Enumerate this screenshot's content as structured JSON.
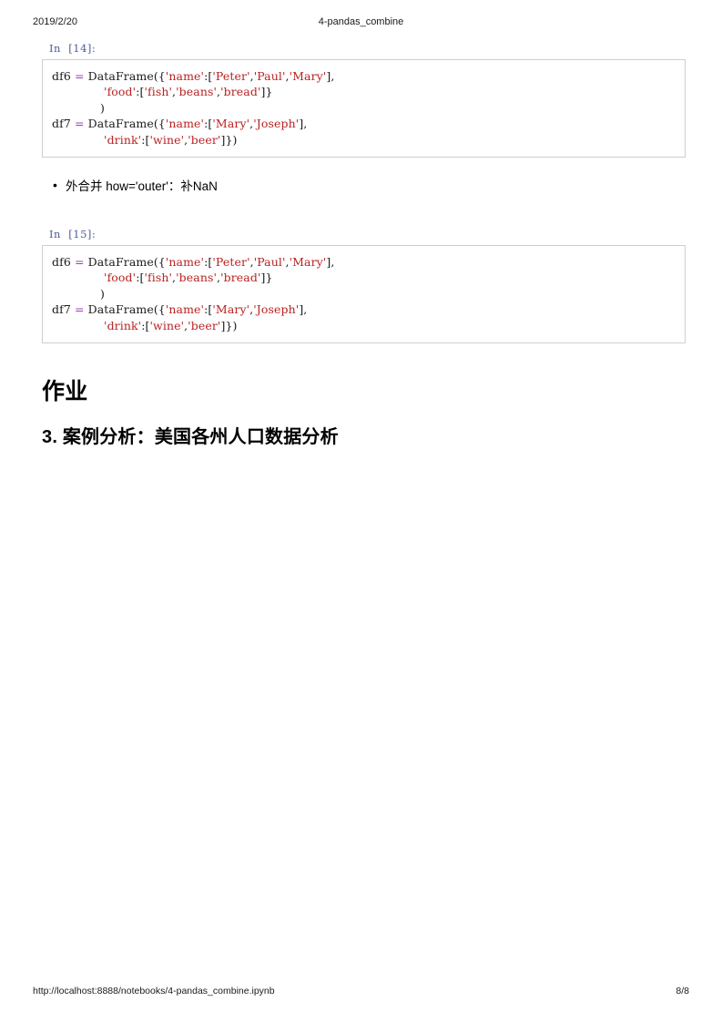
{
  "header": {
    "date": "2019/2/20",
    "title": "4-pandas_combine"
  },
  "footer": {
    "url": "http://localhost:8888/notebooks/4-pandas_combine.ipynb",
    "page": "8/8"
  },
  "cells": [
    {
      "prompt": "In  [14]:",
      "lines": [
        [
          {
            "t": "df6 ",
            "c": "name"
          },
          {
            "t": "=",
            "c": "op"
          },
          {
            "t": " DataFrame({",
            "c": "name"
          },
          {
            "t": "'name'",
            "c": "str"
          },
          {
            "t": ":[",
            "c": "name"
          },
          {
            "t": "'Peter'",
            "c": "str"
          },
          {
            "t": ",",
            "c": "name"
          },
          {
            "t": "'Paul'",
            "c": "str"
          },
          {
            "t": ",",
            "c": "name"
          },
          {
            "t": "'Mary'",
            "c": "str"
          },
          {
            "t": "],",
            "c": "name"
          }
        ],
        [
          {
            "t": "              ",
            "c": "name"
          },
          {
            "t": "'food'",
            "c": "str"
          },
          {
            "t": ":[",
            "c": "name"
          },
          {
            "t": "'fish'",
            "c": "str"
          },
          {
            "t": ",",
            "c": "name"
          },
          {
            "t": "'beans'",
            "c": "str"
          },
          {
            "t": ",",
            "c": "name"
          },
          {
            "t": "'bread'",
            "c": "str"
          },
          {
            "t": "]}",
            "c": "name"
          }
        ],
        [
          {
            "t": "             )",
            "c": "name"
          }
        ],
        [
          {
            "t": "df7 ",
            "c": "name"
          },
          {
            "t": "=",
            "c": "op"
          },
          {
            "t": " DataFrame({",
            "c": "name"
          },
          {
            "t": "'name'",
            "c": "str"
          },
          {
            "t": ":[",
            "c": "name"
          },
          {
            "t": "'Mary'",
            "c": "str"
          },
          {
            "t": ",",
            "c": "name"
          },
          {
            "t": "'Joseph'",
            "c": "str"
          },
          {
            "t": "],",
            "c": "name"
          }
        ],
        [
          {
            "t": "              ",
            "c": "name"
          },
          {
            "t": "'drink'",
            "c": "str"
          },
          {
            "t": ":[",
            "c": "name"
          },
          {
            "t": "'wine'",
            "c": "str"
          },
          {
            "t": ",",
            "c": "name"
          },
          {
            "t": "'beer'",
            "c": "str"
          },
          {
            "t": "]})",
            "c": "name"
          }
        ]
      ]
    },
    {
      "prompt": "In  [15]:",
      "lines": [
        [
          {
            "t": "df6 ",
            "c": "name"
          },
          {
            "t": "=",
            "c": "op"
          },
          {
            "t": " DataFrame({",
            "c": "name"
          },
          {
            "t": "'name'",
            "c": "str"
          },
          {
            "t": ":[",
            "c": "name"
          },
          {
            "t": "'Peter'",
            "c": "str"
          },
          {
            "t": ",",
            "c": "name"
          },
          {
            "t": "'Paul'",
            "c": "str"
          },
          {
            "t": ",",
            "c": "name"
          },
          {
            "t": "'Mary'",
            "c": "str"
          },
          {
            "t": "],",
            "c": "name"
          }
        ],
        [
          {
            "t": "              ",
            "c": "name"
          },
          {
            "t": "'food'",
            "c": "str"
          },
          {
            "t": ":[",
            "c": "name"
          },
          {
            "t": "'fish'",
            "c": "str"
          },
          {
            "t": ",",
            "c": "name"
          },
          {
            "t": "'beans'",
            "c": "str"
          },
          {
            "t": ",",
            "c": "name"
          },
          {
            "t": "'bread'",
            "c": "str"
          },
          {
            "t": "]}",
            "c": "name"
          }
        ],
        [
          {
            "t": "             )",
            "c": "name"
          }
        ],
        [
          {
            "t": "df7 ",
            "c": "name"
          },
          {
            "t": "=",
            "c": "op"
          },
          {
            "t": " DataFrame({",
            "c": "name"
          },
          {
            "t": "'name'",
            "c": "str"
          },
          {
            "t": ":[",
            "c": "name"
          },
          {
            "t": "'Mary'",
            "c": "str"
          },
          {
            "t": ",",
            "c": "name"
          },
          {
            "t": "'Joseph'",
            "c": "str"
          },
          {
            "t": "],",
            "c": "name"
          }
        ],
        [
          {
            "t": "              ",
            "c": "name"
          },
          {
            "t": "'drink'",
            "c": "str"
          },
          {
            "t": ":[",
            "c": "name"
          },
          {
            "t": "'wine'",
            "c": "str"
          },
          {
            "t": ",",
            "c": "name"
          },
          {
            "t": "'beer'",
            "c": "str"
          },
          {
            "t": "]})",
            "c": "name"
          }
        ]
      ]
    }
  ],
  "bullets": [
    "外合并 how='outer'：补NaN"
  ],
  "headings": {
    "h1": "作业",
    "h2": "3. 案例分析：美国各州人口数据分析"
  },
  "colors": {
    "string_literal": "#ba2121",
    "operator": "#9a41b7",
    "prompt": "#4b5c9b",
    "cell_border": "#cfcfcf",
    "text": "#1a1a1a"
  }
}
